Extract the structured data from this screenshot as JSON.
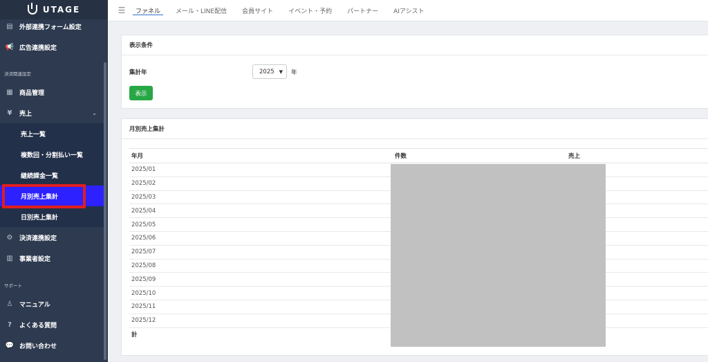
{
  "app": {
    "logo_text": "UTAGE"
  },
  "topbar": {
    "tabs": [
      {
        "label": "ファネル"
      },
      {
        "label": "メール・LINE配信"
      },
      {
        "label": "会員サイト"
      },
      {
        "label": "イベント・予約"
      },
      {
        "label": "パートナー"
      },
      {
        "label": "AIアシスト"
      }
    ]
  },
  "sidebar": {
    "items": {
      "external_form": "外部連携フォーム設定",
      "ad_linkage": "広告連携設定",
      "payment_section": "決済関連設定",
      "product_mgmt": "商品管理",
      "sales": "売上",
      "sales_list": "売上一覧",
      "installments": "複数回・分割払い一覧",
      "subscriptions": "継続課金一覧",
      "monthly_sales": "月別売上集計",
      "daily_sales": "日別売上集計",
      "payment_linkage": "決済連携設定",
      "business_settings": "事業者設定",
      "support_section": "サポート",
      "manual": "マニュアル",
      "faq": "よくある質問",
      "contact": "お問い合わせ"
    },
    "icons": {
      "external_form": "form-icon",
      "ad_linkage": "megaphone-icon",
      "product_mgmt": "basket-icon",
      "sales": "yen-icon",
      "payment_linkage": "gear-icon",
      "business_settings": "building-icon",
      "manual": "user-icon",
      "faq": "question-icon",
      "contact": "chat-icon"
    }
  },
  "filter": {
    "title": "表示条件",
    "year_label": "集計年",
    "year_value": "2025",
    "year_unit": "年",
    "submit_label": "表示"
  },
  "monthly": {
    "title": "月別売上集計",
    "columns": [
      "年月",
      "件数",
      "売上"
    ],
    "rows": [
      "2025/01",
      "2025/02",
      "2025/03",
      "2025/04",
      "2025/05",
      "2025/06",
      "2025/07",
      "2025/08",
      "2025/09",
      "2025/10",
      "2025/11",
      "2025/12"
    ],
    "total_label": "計"
  },
  "colors": {
    "accent": "#2d21ff",
    "highlight": "#e01e1e",
    "button": "#28a745"
  }
}
